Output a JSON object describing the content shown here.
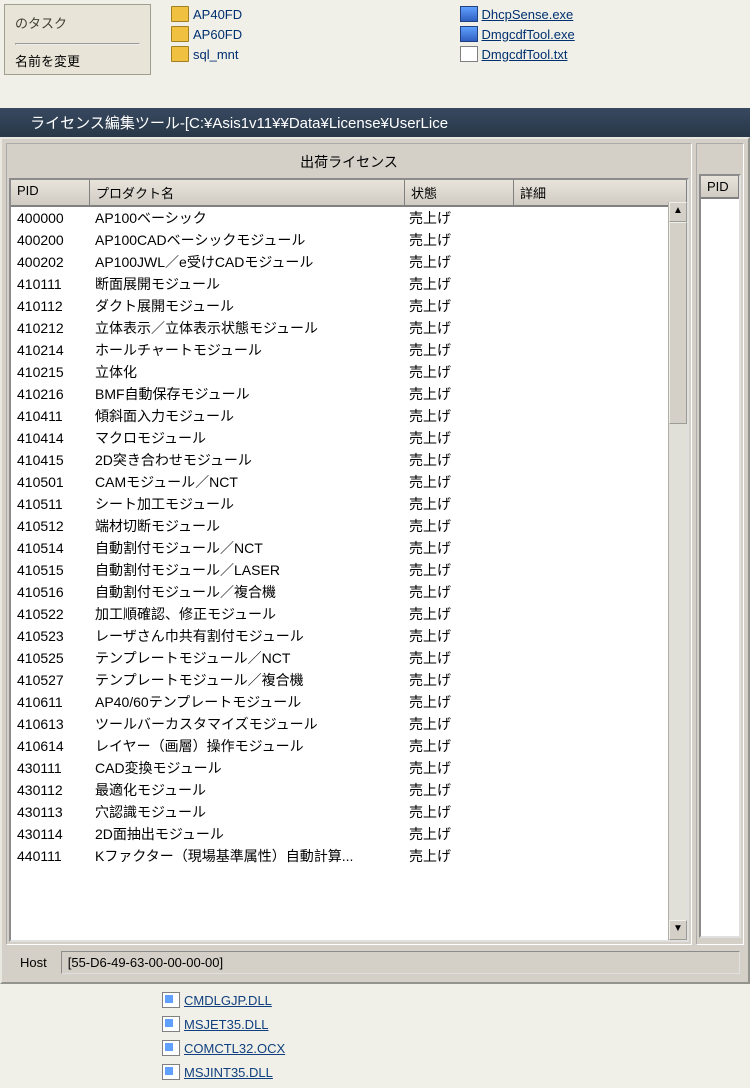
{
  "desktop": {
    "task_panel": {
      "title": "のタスク",
      "link": "名前を変更"
    },
    "folders": [
      "AP40FD",
      "AP60FD",
      "sql_mnt"
    ],
    "files_right": [
      {
        "name": "DhcpSense.exe",
        "type": "exe"
      },
      {
        "name": "DmgcdfTool.exe",
        "type": "exe"
      },
      {
        "name": "DmgcdfTool.txt",
        "type": "txt"
      }
    ]
  },
  "window": {
    "title": "ライセンス編集ツール-[C:¥Asis1v11¥¥Data¥License¥UserLice"
  },
  "left_panel": {
    "caption": "出荷ライセンス",
    "columns": {
      "pid": "PID",
      "name": "プロダクト名",
      "status": "状態",
      "detail": "詳細"
    },
    "rows": [
      {
        "pid": "400000",
        "name": "AP100ベーシック",
        "status": "売上げ"
      },
      {
        "pid": "400200",
        "name": "AP100CADベーシックモジュール",
        "status": "売上げ"
      },
      {
        "pid": "400202",
        "name": "AP100JWL／e受けCADモジュール",
        "status": "売上げ"
      },
      {
        "pid": "410111",
        "name": "断面展開モジュール",
        "status": "売上げ"
      },
      {
        "pid": "410112",
        "name": "ダクト展開モジュール",
        "status": "売上げ"
      },
      {
        "pid": "410212",
        "name": "立体表示／立体表示状態モジュール",
        "status": "売上げ"
      },
      {
        "pid": "410214",
        "name": "ホールチャートモジュール",
        "status": "売上げ"
      },
      {
        "pid": "410215",
        "name": "立体化",
        "status": "売上げ"
      },
      {
        "pid": "410216",
        "name": "BMF自動保存モジュール",
        "status": "売上げ"
      },
      {
        "pid": "410411",
        "name": "傾斜面入力モジュール",
        "status": "売上げ"
      },
      {
        "pid": "410414",
        "name": "マクロモジュール",
        "status": "売上げ"
      },
      {
        "pid": "410415",
        "name": "2D突き合わせモジュール",
        "status": "売上げ"
      },
      {
        "pid": "410501",
        "name": "CAMモジュール／NCT",
        "status": "売上げ"
      },
      {
        "pid": "410511",
        "name": "シート加工モジュール",
        "status": "売上げ"
      },
      {
        "pid": "410512",
        "name": "端材切断モジュール",
        "status": "売上げ"
      },
      {
        "pid": "410514",
        "name": "自動割付モジュール／NCT",
        "status": "売上げ"
      },
      {
        "pid": "410515",
        "name": "自動割付モジュール／LASER",
        "status": "売上げ"
      },
      {
        "pid": "410516",
        "name": "自動割付モジュール／複合機",
        "status": "売上げ"
      },
      {
        "pid": "410522",
        "name": "加工順確認、修正モジュール",
        "status": "売上げ"
      },
      {
        "pid": "410523",
        "name": "レーザさん巾共有割付モジュール",
        "status": "売上げ"
      },
      {
        "pid": "410525",
        "name": "テンプレートモジュール／NCT",
        "status": "売上げ"
      },
      {
        "pid": "410527",
        "name": "テンプレートモジュール／複合機",
        "status": "売上げ"
      },
      {
        "pid": "410611",
        "name": "AP40/60テンプレートモジュール",
        "status": "売上げ"
      },
      {
        "pid": "410613",
        "name": "ツールバーカスタマイズモジュール",
        "status": "売上げ"
      },
      {
        "pid": "410614",
        "name": "レイヤー（画層）操作モジュール",
        "status": "売上げ"
      },
      {
        "pid": "430111",
        "name": "CAD変換モジュール",
        "status": "売上げ"
      },
      {
        "pid": "430112",
        "name": "最適化モジュール",
        "status": "売上げ"
      },
      {
        "pid": "430113",
        "name": "穴認識モジュール",
        "status": "売上げ"
      },
      {
        "pid": "430114",
        "name": "2D面抽出モジュール",
        "status": "売上げ"
      },
      {
        "pid": "440111",
        "name": "Kファクター（現場基準属性）自動計算...",
        "status": "売上げ"
      }
    ]
  },
  "right_panel": {
    "columns": {
      "pid": "PID"
    }
  },
  "host": {
    "label": "Host",
    "value": "[55-D6-49-63-00-00-00-00]"
  },
  "bottom_files": [
    "CMDLGJP.DLL",
    "MSJET35.DLL",
    "COMCTL32.OCX",
    "MSJINT35.DLL"
  ]
}
